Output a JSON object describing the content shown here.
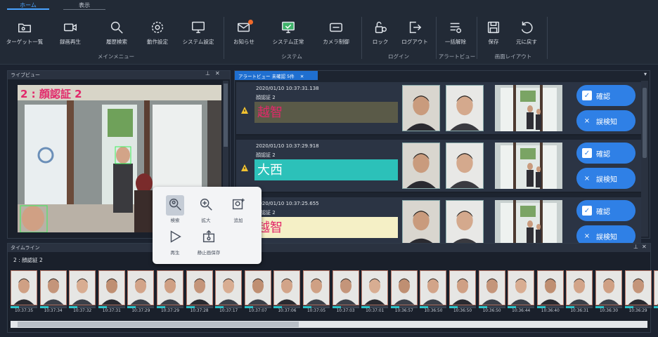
{
  "tabs": [
    {
      "label": "ホーム",
      "active": true
    },
    {
      "label": "表示",
      "active": false
    }
  ],
  "ribbon": {
    "buttons": [
      {
        "label": "ターゲット一覧",
        "icon": "folder-icon"
      },
      {
        "label": "録画再生",
        "icon": "video-camera-icon"
      },
      {
        "label": "履歴検索",
        "icon": "search-icon"
      },
      {
        "label": "動作設定",
        "icon": "gear-icon"
      },
      {
        "label": "システム設定",
        "icon": "monitor-icon"
      },
      {
        "label": "お知らせ",
        "icon": "mail-icon"
      },
      {
        "label": "システム正常",
        "icon": "monitor-check-icon"
      },
      {
        "label": "カメラ制御",
        "icon": "camera-control-icon"
      },
      {
        "label": "ロック",
        "icon": "lock-icon"
      },
      {
        "label": "ログアウト",
        "icon": "logout-icon"
      },
      {
        "label": "一括解除",
        "icon": "clear-all-icon"
      },
      {
        "label": "保存",
        "icon": "save-icon"
      },
      {
        "label": "元に戻す",
        "icon": "undo-icon"
      }
    ],
    "groups": [
      "メインメニュー",
      "システム",
      "ログイン",
      "アラートビュー",
      "画面レイアウト"
    ]
  },
  "live": {
    "title": "ライブビュー",
    "camera_label": "2 : 顔認証 2"
  },
  "alerts": {
    "tab_label": "アラートビュー 未確認 5件",
    "items": [
      {
        "timestamp": "2020/01/10 10:37:31.138",
        "camera": "顔認証 2",
        "name": "越智",
        "name_bg": "#5a5a48",
        "name_color": "#e2286a"
      },
      {
        "timestamp": "2020/01/10 10:37:29.918",
        "camera": "顔認証 2",
        "name": "大西",
        "name_bg": "#2cc1b9",
        "name_color": "#ffffff"
      },
      {
        "timestamp": "2020/01/10 10:37:25.655",
        "camera": "顔認証 2",
        "name": "越智",
        "name_bg": "#f5f0c6",
        "name_color": "#e2286a"
      }
    ],
    "confirm_label": "確認",
    "false_detect_label": "誤検知"
  },
  "timeline": {
    "title": "タイムライン",
    "camera_label": "2 : 顔認証 2",
    "times": [
      "10:37:35",
      "10:37:34",
      "10:37:32",
      "10:37:31",
      "10:37:29",
      "10:37:29",
      "10:37:28",
      "10:37:17",
      "10:37:07",
      "10:37:06",
      "10:37:05",
      "10:37:03",
      "10:37:01",
      "10:36:57",
      "10:36:50",
      "10:36:50",
      "10:36:50",
      "10:36:44",
      "10:36:40",
      "10:36:31",
      "10:36:30",
      "10:36:29",
      "10:36:28"
    ]
  },
  "popup": {
    "items": [
      {
        "label": "検索",
        "icon": "search-face-icon"
      },
      {
        "label": "拡大",
        "icon": "zoom-in-icon"
      },
      {
        "label": "追加",
        "icon": "add-image-icon"
      },
      {
        "label": "再生",
        "icon": "play-icon"
      },
      {
        "label": "静止画保存",
        "icon": "save-image-icon"
      }
    ]
  },
  "colors": {
    "accent": "#2f80e6",
    "alert_tab": "#1f6fd0",
    "warning": "#f2c230",
    "teal": "#2fc3c9"
  }
}
